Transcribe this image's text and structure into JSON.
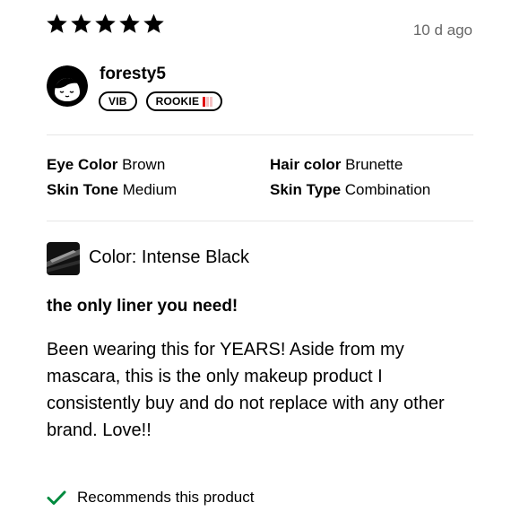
{
  "review": {
    "rating": 5,
    "time_ago": "10 d ago",
    "title": "the only liner you need!",
    "body": "Been wearing this for YEARS! Aside from my mascara, this is the only makeup product I consistently buy and do not replace with any other brand. Love!!"
  },
  "user": {
    "name": "foresty5",
    "badges": [
      "VIB",
      "ROOKIE"
    ],
    "rookie_colors": [
      "#e0000b",
      "#f4c1c3",
      "#f4c1c3"
    ]
  },
  "attributes": {
    "eye_color_label": "Eye Color",
    "eye_color_value": "Brown",
    "hair_color_label": "Hair color",
    "hair_color_value": "Brunette",
    "skin_tone_label": "Skin Tone",
    "skin_tone_value": "Medium",
    "skin_type_label": "Skin Type",
    "skin_type_value": "Combination"
  },
  "product": {
    "color_label": "Color: Intense Black"
  },
  "recommend": {
    "text": "Recommends this product",
    "check_color": "#008a3e"
  }
}
